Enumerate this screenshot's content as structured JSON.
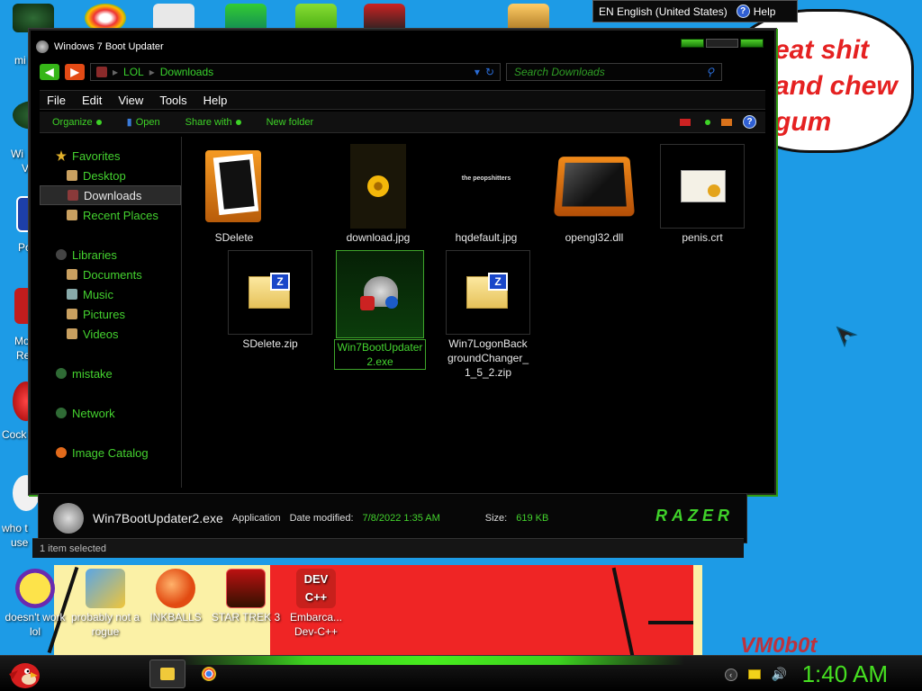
{
  "colors": {
    "accent": "#3ed327",
    "desktop": "#1d9be6",
    "window_bg": "#000000"
  },
  "wallpaper": {
    "speech_text": "eat shit and chew gum",
    "watermark": "VM0b0t"
  },
  "language_bar": {
    "language": "EN English (United States)",
    "help": "Help",
    "icon": "help-icon"
  },
  "desktop_icons": [
    {
      "label": "doesn't work lol",
      "icon": "yahoo-messenger-icon"
    },
    {
      "label": "probably not a rogue",
      "icon": "gears-icon"
    },
    {
      "label": "INKBALLS",
      "icon": "inkball-icon"
    },
    {
      "label": "STAR TREK 3",
      "icon": "star-wars-icon"
    },
    {
      "label": "Embarca... Dev-C++",
      "icon": "dev-cpp-icon"
    }
  ],
  "edge_labels": [
    "mi",
    "Wi",
    "V",
    "Po",
    "Mo",
    "Re",
    "Cock",
    "who t",
    "use"
  ],
  "window": {
    "title": "Windows 7 Boot Updater",
    "address": {
      "segments": [
        "LOL",
        "Downloads"
      ]
    },
    "search_placeholder": "Search Downloads",
    "menu": [
      "File",
      "Edit",
      "View",
      "Tools",
      "Help"
    ],
    "toolbar": {
      "organize": "Organize",
      "open": "Open",
      "share_with": "Share with",
      "new_folder": "New folder"
    },
    "nav": {
      "favorites": "Favorites",
      "desktop": "Desktop",
      "downloads": "Downloads",
      "recent_places": "Recent Places",
      "libraries": "Libraries",
      "documents": "Documents",
      "music": "Music",
      "pictures": "Pictures",
      "videos": "Videos",
      "mistake": "mistake",
      "network": "Network",
      "image_catalog": "Image Catalog"
    },
    "files": [
      {
        "name": "SDelete",
        "icon": "folder-icon"
      },
      {
        "name": "download.jpg",
        "icon": "flower-image-icon"
      },
      {
        "name": "hqdefault.jpg",
        "icon": "image-thumbnail-icon"
      },
      {
        "name": "opengl32.dll",
        "icon": "dll-icon"
      },
      {
        "name": "penis.crt",
        "icon": "certificate-icon"
      },
      {
        "name": "SDelete.zip",
        "icon": "zip-folder-icon"
      },
      {
        "name": "Win7BootUpdater2.exe",
        "icon": "exe-icon",
        "selected": true
      },
      {
        "name": "Win7LogonBackgroundChanger_1_5_2.zip",
        "icon": "zip-folder-icon"
      }
    ],
    "thumb_text": "the peopshitters",
    "details": {
      "filename": "Win7BootUpdater2.exe",
      "type": "Application",
      "date_label": "Date modified:",
      "date_value": "7/8/2022 1:35 AM",
      "size_label": "Size:",
      "size_value": "619 KB",
      "brand": "RAZER"
    },
    "status": "1 item selected"
  },
  "taskbar": {
    "clock": "1:40 AM"
  }
}
